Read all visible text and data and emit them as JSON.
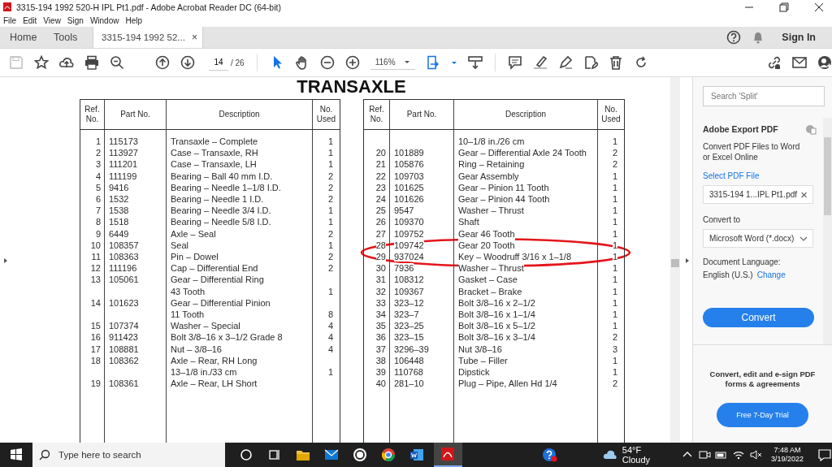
{
  "window": {
    "title": "3315-194 1992 520-H IPL Pt1.pdf - Adobe Acrobat Reader DC (64-bit)",
    "menu": [
      "File",
      "Edit",
      "View",
      "Sign",
      "Window",
      "Help"
    ]
  },
  "tabs": [
    {
      "label": "Home",
      "selected": false
    },
    {
      "label": "Tools",
      "selected": false
    },
    {
      "label": "3315-194 1992 52...",
      "selected": true,
      "close": "×"
    }
  ],
  "account": {
    "sign_in": "Sign In"
  },
  "toolbar": {
    "page": "14",
    "page_total": "/ 26",
    "zoom": "116%"
  },
  "document": {
    "title": "TRANSAXLE",
    "tables": [
      {
        "columns": [
          "Ref. No.",
          "Part No.",
          "Description",
          "No. Used"
        ],
        "rows": [
          {
            "ref": "1",
            "part": "115173",
            "description": [
              "Transaxle – Complete"
            ],
            "used": "1"
          },
          {
            "ref": "2",
            "part": "113927",
            "description": [
              "Case – Transaxle, RH"
            ],
            "used": "1"
          },
          {
            "ref": "3",
            "part": "111201",
            "description": [
              "Case – Transaxle, LH"
            ],
            "used": "1"
          },
          {
            "ref": "4",
            "part": "111199",
            "description": [
              "Bearing – Ball 40 mm I.D."
            ],
            "used": "2"
          },
          {
            "ref": "5",
            "part": "9416",
            "description": [
              "Bearing – Needle 1–1/8 I.D."
            ],
            "used": "2"
          },
          {
            "ref": "6",
            "part": "1532",
            "description": [
              "Bearing – Needle 1 I.D."
            ],
            "used": "2"
          },
          {
            "ref": "7",
            "part": "1538",
            "description": [
              "Bearing – Needle 3/4 I.D."
            ],
            "used": "1"
          },
          {
            "ref": "8",
            "part": "1518",
            "description": [
              "Bearing – Needle 5/8 I.D."
            ],
            "used": "1"
          },
          {
            "ref": "9",
            "part": "6449",
            "description": [
              "Axle – Seal"
            ],
            "used": "2"
          },
          {
            "ref": "10",
            "part": "108357",
            "description": [
              "Seal"
            ],
            "used": "1"
          },
          {
            "ref": "11",
            "part": "108363",
            "description": [
              "Pin – Dowel"
            ],
            "used": "2"
          },
          {
            "ref": "12",
            "part": "111196",
            "description": [
              "Cap – Differential End"
            ],
            "used": "2"
          },
          {
            "ref": "13",
            "part": "105061",
            "description": [
              "Gear – Differential Ring",
              "43 Tooth"
            ],
            "used": "1"
          },
          {
            "ref": "14",
            "part": "101623",
            "description": [
              "Gear – Differential Pinion",
              "11 Tooth"
            ],
            "used": "8"
          },
          {
            "ref": "15",
            "part": "107374",
            "description": [
              "Washer – Special"
            ],
            "used": "4"
          },
          {
            "ref": "16",
            "part": "911423",
            "description": [
              "Bolt 3/8–16 x 3–1/2 Grade 8"
            ],
            "used": "4"
          },
          {
            "ref": "17",
            "part": "108881",
            "description": [
              "Nut – 3/8–16"
            ],
            "used": "4"
          },
          {
            "ref": "18",
            "part": "108362",
            "description": [
              "Axle – Rear, RH Long",
              "13–1/8 in./33 cm"
            ],
            "used": "1"
          },
          {
            "ref": "19",
            "part": "108361",
            "description": [
              "Axle – Rear, LH Short"
            ]
          }
        ]
      },
      {
        "columns": [
          "Ref. No.",
          "Part No.",
          "Description",
          "No. Used"
        ],
        "rows": [
          {
            "description": [
              "10–1/8 in./26 cm"
            ],
            "used": "1"
          },
          {
            "ref": "20",
            "part": "101889",
            "description": [
              "Gear – Differential Axle 24 Tooth"
            ],
            "used": "2"
          },
          {
            "ref": "21",
            "part": "105876",
            "description": [
              "Ring – Retaining"
            ],
            "used": "2"
          },
          {
            "ref": "22",
            "part": "109703",
            "description": [
              "Gear Assembly"
            ],
            "used": "1"
          },
          {
            "ref": "23",
            "part": "101625",
            "description": [
              "Gear – Pinion 11 Tooth"
            ],
            "used": "1"
          },
          {
            "ref": "24",
            "part": "101626",
            "description": [
              "Gear – Pinion 44 Tooth"
            ],
            "used": "1"
          },
          {
            "ref": "25",
            "part": "9547",
            "description": [
              "Washer – Thrust"
            ],
            "used": "1"
          },
          {
            "ref": "26",
            "part": "109370",
            "description": [
              "Shaft"
            ],
            "used": "1"
          },
          {
            "ref": "27",
            "part": "109752",
            "description": [
              "Gear 46 Tooth"
            ],
            "used": "1"
          },
          {
            "ref": "28",
            "part": "109742",
            "description": [
              "Gear 20 Tooth"
            ],
            "used": "1"
          },
          {
            "ref": "29",
            "part": "937024",
            "description": [
              "Key – Woodruff 3/16 x 1–1/8"
            ],
            "used": "1"
          },
          {
            "ref": "30",
            "part": "7936",
            "description": [
              "Washer – Thrust"
            ],
            "used": "1"
          },
          {
            "ref": "31",
            "part": "108312",
            "description": [
              "Gasket – Case"
            ],
            "used": "1"
          },
          {
            "ref": "32",
            "part": "109367",
            "description": [
              "Bracket – Brake"
            ],
            "used": "1"
          },
          {
            "ref": "33",
            "part": "323–12",
            "description": [
              "Bolt 3/8–16 x 2–1/2"
            ],
            "used": "1"
          },
          {
            "ref": "34",
            "part": "323–7",
            "description": [
              "Bolt 3/8–16 x 1–1/4"
            ],
            "used": "1"
          },
          {
            "ref": "35",
            "part": "323–25",
            "description": [
              "Bolt 3/8–16 x 5–1/2"
            ],
            "used": "1"
          },
          {
            "ref": "36",
            "part": "323–15",
            "description": [
              "Bolt 3/8–16 x 3–1/4"
            ],
            "used": "2"
          },
          {
            "ref": "37",
            "part": "3296–39",
            "description": [
              "Nut 3/8–16"
            ],
            "used": "3"
          },
          {
            "ref": "38",
            "part": "106448",
            "description": [
              "Tube – Filler"
            ],
            "used": "1"
          },
          {
            "ref": "39",
            "part": "110768",
            "description": [
              "Dipstick"
            ],
            "used": "1"
          },
          {
            "ref": "40",
            "part": "281–10",
            "description": [
              "Plug – Pipe, Allen Hd 1/4"
            ],
            "used": "2"
          }
        ]
      }
    ]
  },
  "side_panel": {
    "search": {
      "placeholder": "Search 'Split'"
    },
    "heading": "Adobe Export PDF",
    "intro": "Convert PDF Files to Word or Excel Online",
    "select_link": "Select PDF File",
    "file": {
      "value": "3315-194 1...IPL Pt1.pdf",
      "clear": "×"
    },
    "convert_to_label": "Convert to",
    "format": "Microsoft Word (*.docx)",
    "language_label": "Document Language:",
    "language": "English (U.S.)",
    "change_link": "Change",
    "convert_button": "Convert",
    "promo": "Convert, edit and e-sign PDF forms & agreements",
    "trial_button": "Free 7-Day Trial"
  },
  "taskbar": {
    "search_placeholder": "Type here to search",
    "weather": "54°F  Cloudy",
    "time": "7:48 AM",
    "date": "3/19/2022"
  }
}
